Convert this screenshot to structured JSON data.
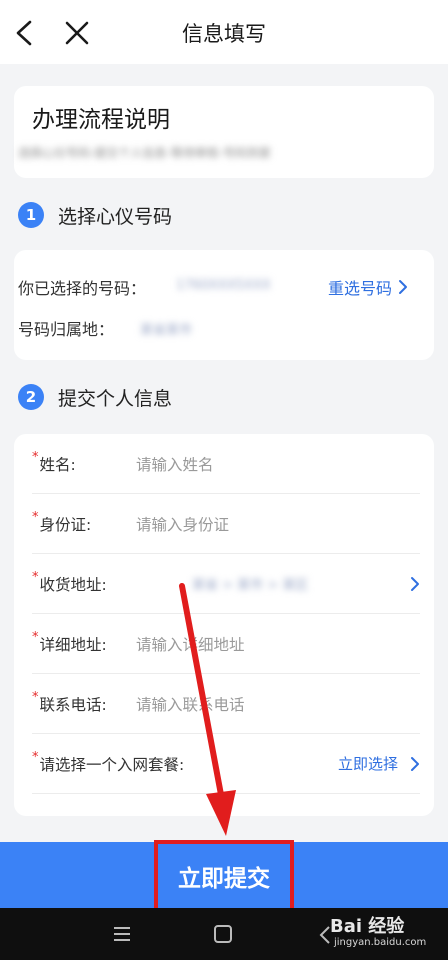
{
  "header": {
    "title": "信息填写"
  },
  "flow": {
    "title": "办理流程说明",
    "desc": "选择心仪号码-提交个人信息-等待审核-号码到家"
  },
  "steps": [
    {
      "num": "1",
      "label": "选择心仪号码"
    },
    {
      "num": "2",
      "label": "提交个人信息"
    }
  ],
  "number_card": {
    "selected_label": "你已选择的号码：",
    "selected_value": "1760XXX5XXX",
    "reselect_label": "重选号码",
    "location_label": "号码归属地：",
    "location_value": "某省某市"
  },
  "form": {
    "fields": [
      {
        "label": "姓名:",
        "placeholder": "请输入姓名"
      },
      {
        "label": "身份证:",
        "placeholder": "请输入身份证"
      },
      {
        "label": "收货地址:",
        "value": "某省 > 某市 > 某区"
      },
      {
        "label": "详细地址:",
        "placeholder": "请输入详细地址"
      },
      {
        "label": "联系电话:",
        "placeholder": "请输入联系电话"
      },
      {
        "label": "请选择一个入网套餐:",
        "action": "立即选择"
      }
    ],
    "required_mark": "*"
  },
  "submit": {
    "label": "立即提交"
  },
  "watermark": {
    "brand": "Bai 经验",
    "url": "jingyan.baidu.com"
  },
  "colors": {
    "accent": "#3b82f6",
    "link": "#2f6fe0",
    "required": "#e52a2a",
    "highlight": "#e11d1d"
  }
}
